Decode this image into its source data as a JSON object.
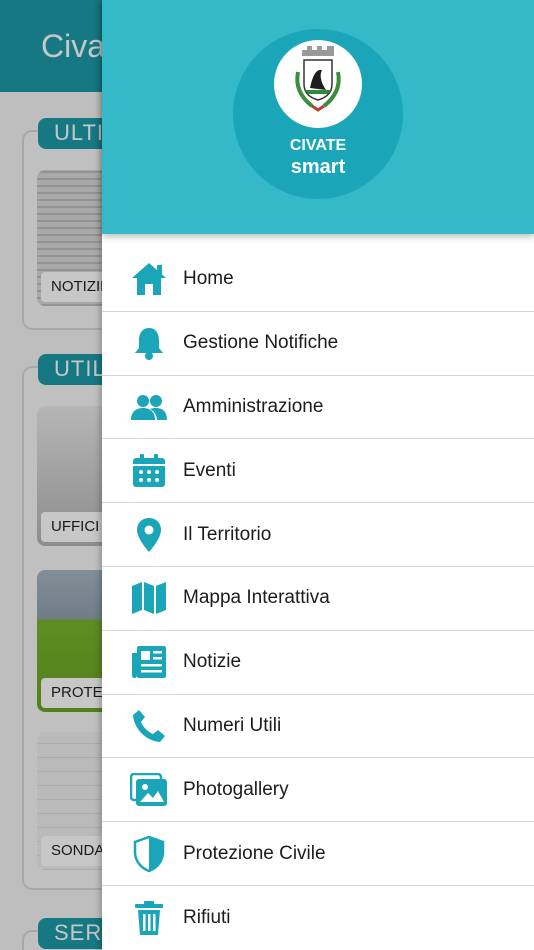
{
  "app": {
    "title": "Civate",
    "sections": [
      {
        "label": "ULTIME"
      },
      {
        "label": "UTILITÀ"
      },
      {
        "label": "SERVIZI"
      }
    ],
    "tiles": [
      {
        "caption": "NOTIZIE"
      },
      {
        "caption": "UFFICI COMUNALI"
      },
      {
        "caption": "PROTEZIONE CIVILE"
      },
      {
        "caption": "SONDAGGI"
      }
    ]
  },
  "drawer": {
    "logo": {
      "line1": "CIVATE",
      "line2": "smart"
    },
    "accent_color": "#1aa6b8",
    "header_color": "#35b9c8",
    "menu": [
      {
        "label": "Home",
        "icon": "home-icon"
      },
      {
        "label": "Gestione Notifiche",
        "icon": "bell-icon"
      },
      {
        "label": "Amministrazione",
        "icon": "users-icon"
      },
      {
        "label": "Eventi",
        "icon": "calendar-icon"
      },
      {
        "label": "Il Territorio",
        "icon": "map-pin-icon"
      },
      {
        "label": "Mappa Interattiva",
        "icon": "map-icon"
      },
      {
        "label": "Notizie",
        "icon": "newspaper-icon"
      },
      {
        "label": "Numeri Utili",
        "icon": "phone-icon"
      },
      {
        "label": "Photogallery",
        "icon": "images-icon"
      },
      {
        "label": "Protezione Civile",
        "icon": "shield-icon"
      },
      {
        "label": "Rifiuti",
        "icon": "trash-icon"
      }
    ]
  }
}
